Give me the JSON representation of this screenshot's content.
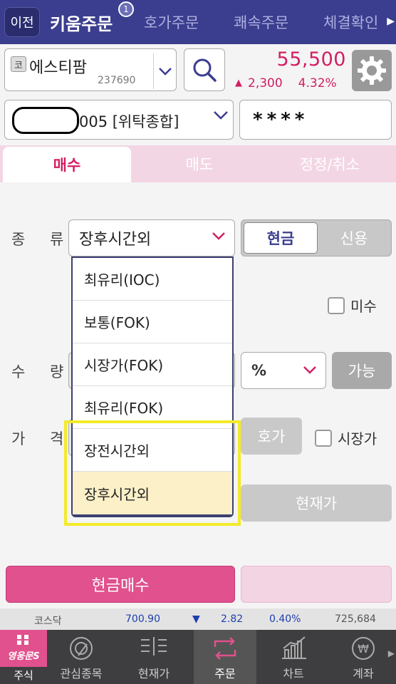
{
  "topbar": {
    "back_label": "이전",
    "tabs": [
      "키움주문",
      "호가주문",
      "쾌속주문",
      "체결확인"
    ],
    "badge": "1",
    "more_arrow": "▶"
  },
  "stock": {
    "market_tag": "코",
    "name": "에스티팜",
    "code": "237690",
    "price": "55,500",
    "change_arrow": "▲",
    "change": "2,300",
    "change_pct": "4.32%"
  },
  "account": {
    "number_suffix": "005 [위탁종합]",
    "password_mask": "****"
  },
  "order_tabs": [
    "매수",
    "매도",
    "정정/취소"
  ],
  "form": {
    "type_label": "종 류",
    "type_value": "장후시간외",
    "seg_cash": "현금",
    "seg_credit": "신용",
    "misu_label": "미수",
    "qty_label": "수 량",
    "pct_value": "%",
    "avail_label": "가능",
    "price_label": "가 격",
    "hoga_label": "호가",
    "market_price_label": "시장가",
    "current_price_label": "현재가"
  },
  "dropdown_items": [
    "최유리(IOC)",
    "보통(FOK)",
    "시장가(FOK)",
    "최유리(FOK)",
    "장전시간외",
    "장후시간외"
  ],
  "dropdown_selected_index": 5,
  "buy_button": "현금매수",
  "ticker": {
    "market": "코스닥",
    "index": "700.90",
    "arrow": "▼",
    "change": "2.82",
    "pct": "0.40%",
    "volume": "725,684"
  },
  "navbar": {
    "stock_menu_logo": "영웅문S",
    "stock_menu_label": "주식",
    "items": [
      "관심종목",
      "현재가",
      "주문",
      "차트",
      "계좌"
    ],
    "active_index": 2,
    "more_arrow": "▶"
  },
  "colors": {
    "brand_navy": "#3b3d8e",
    "accent_pink": "#d21f63",
    "buy_pink": "#e0518e",
    "highlight_yellow": "#f3ea2a",
    "down_blue": "#1e3fb0"
  }
}
